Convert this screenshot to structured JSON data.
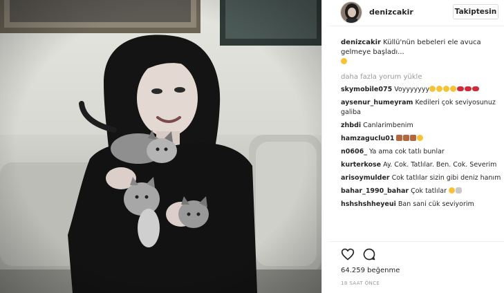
{
  "post": {
    "username": "denizcakir",
    "follow_label": "Takiptesin",
    "caption": {
      "user": "denizcakir",
      "text": " Küllü'nün bebeleri ele avuca gelmeye başladı..."
    },
    "load_more_label": "daha fazla yorum yükle",
    "comments": [
      {
        "user": "skymobile075",
        "text": " Voyyyyyyy",
        "emoji": [
          "y",
          "y",
          "y",
          "y",
          "r",
          "r",
          "r"
        ]
      },
      {
        "user": "aysenur_humeyram",
        "text": " Kedileri çok seviyosunuz galiba",
        "emoji": []
      },
      {
        "user": "zhbdi",
        "text": " Canlarimbenim",
        "emoji": []
      },
      {
        "user": "hamzaguclu01",
        "text": " ",
        "emoji": [
          "m",
          "m",
          "m",
          "y"
        ]
      },
      {
        "user": "n0606_",
        "text": " Ya ama cok tatlı bunlar",
        "emoji": []
      },
      {
        "user": "kurterkose",
        "text": " Ay. Cok. Tatlılar. Ben. Cok. Severim",
        "emoji": []
      },
      {
        "user": "arisoymulder",
        "text": " Cok tatlılar sizin gibi deniz hanım",
        "emoji": []
      },
      {
        "user": "bahar_1990_bahar",
        "text": " Çok tatlılar ",
        "emoji": [
          "y",
          "s"
        ]
      },
      {
        "user": "hshshshheyeui",
        "text": " Ban sani cük seviyorim",
        "emoji": []
      }
    ],
    "likes_label": "64.259 beğenme",
    "time_label": "18 SAAT ÖNCE"
  }
}
